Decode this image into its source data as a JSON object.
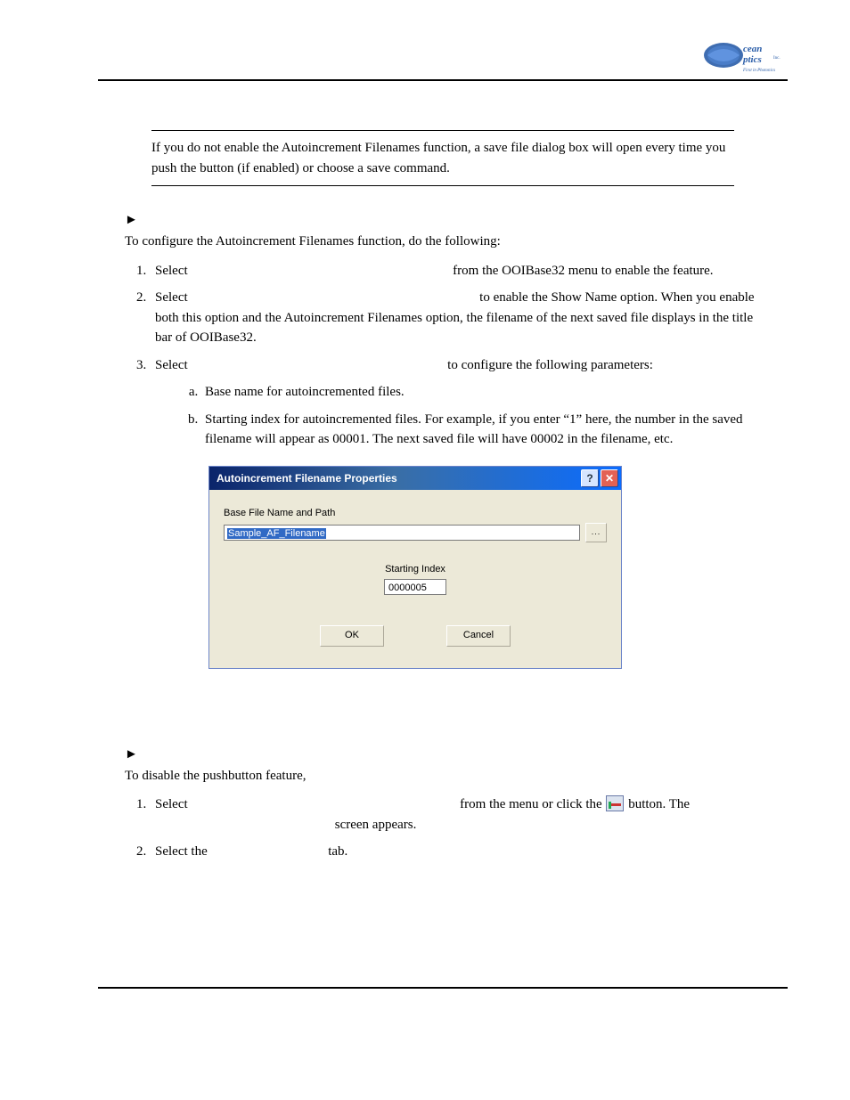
{
  "logo_alt": "Ocean Optics Inc.",
  "note": "If you do not enable the Autoincrement Filenames function, a save file dialog box will open every time you push the button (if enabled) or choose a save command.",
  "procedure1": {
    "intro": "To configure the Autoincrement Filenames function, do the following:",
    "steps": [
      {
        "pre": "Select",
        "post": "from the OOIBase32 menu to enable the feature."
      },
      {
        "pre": "Select",
        "post": "to enable the Show Name option. When you enable both this option and the Autoincrement Filenames option, the filename of the next saved file displays in the title bar of OOIBase32."
      },
      {
        "pre": "Select",
        "post": "to configure the following parameters:",
        "sub": [
          "Base name for autoincremented files.",
          "Starting index for autoincremented files. For example, if you enter “1” here, the number in the saved filename will appear as 00001. The next saved file will have 00002 in the filename, etc."
        ]
      }
    ]
  },
  "dialog": {
    "title": "Autoincrement Filename Properties",
    "help": "?",
    "close": "✕",
    "base_label": "Base File Name and Path",
    "base_value": "Sample_AF_Filename",
    "browse": "...",
    "start_label": "Starting Index",
    "start_value": "0000005",
    "ok": "OK",
    "cancel": "Cancel"
  },
  "procedure2": {
    "intro": "To disable the pushbutton feature,",
    "steps": [
      {
        "pre": "Select",
        "mid": "from the menu or click the",
        "post1": "button. The",
        "post2": "screen appears."
      },
      {
        "pre": "Select the",
        "post": "tab."
      }
    ]
  }
}
